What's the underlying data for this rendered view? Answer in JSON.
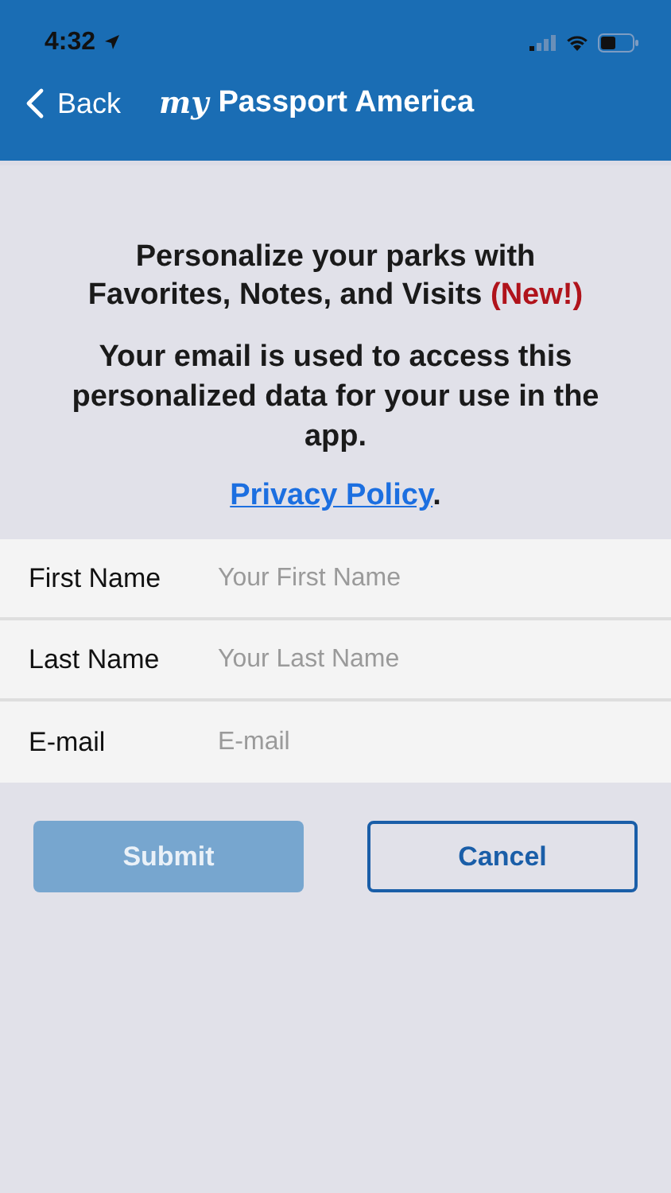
{
  "status_bar": {
    "time": "4:32"
  },
  "nav": {
    "back": "Back",
    "logo_prefix": "my",
    "title": "Passport America"
  },
  "intro": {
    "heading": "Personalize your parks with Favorites, Notes, and Visits",
    "new_tag": "(New!)",
    "body": "Your email is used to access this personalized data for your use in the app.",
    "link": "Privacy Policy",
    "link_suffix": "."
  },
  "fields": [
    {
      "label": "First Name",
      "placeholder": "Your First Name"
    },
    {
      "label": "Last Name",
      "placeholder": "Your Last Name"
    },
    {
      "label": "E-mail",
      "placeholder": "E-mail"
    }
  ],
  "buttons": [
    {
      "label": "Submit",
      "kind": "primary",
      "disabled": true
    },
    {
      "label": "Cancel",
      "kind": "outline",
      "disabled": false
    }
  ]
}
